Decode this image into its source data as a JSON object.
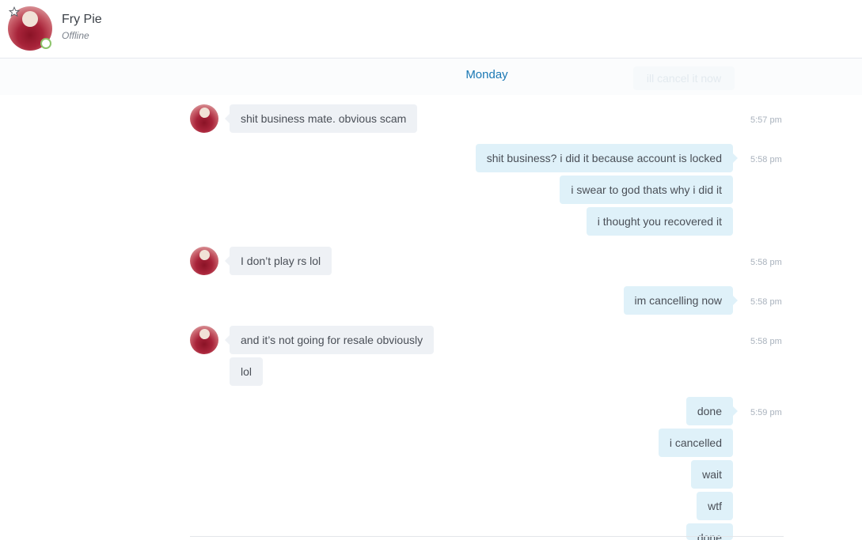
{
  "header": {
    "contact_name": "Fry Pie",
    "contact_status": "Offline"
  },
  "day": {
    "label": "Monday",
    "ghost_text": "ill cancel it now"
  },
  "messages": [
    {
      "text": "shit business mate. obvious scam",
      "time": "5:57 pm"
    },
    {
      "text": "shit business? i did it because account is locked",
      "time": "5:58 pm"
    },
    {
      "text": "i swear to god thats why i did it"
    },
    {
      "text": "i thought you recovered it"
    },
    {
      "text": "I don’t play rs lol",
      "time": "5:58 pm"
    },
    {
      "text": "im cancelling now",
      "time": "5:58 pm"
    },
    {
      "text": "and it’s not going for resale obviously",
      "time": "5:58 pm"
    },
    {
      "text": "lol"
    },
    {
      "text": "done",
      "time": "5:59 pm"
    },
    {
      "text": "i cancelled"
    },
    {
      "text": "wait"
    },
    {
      "text": "wtf"
    },
    {
      "text": "done"
    }
  ],
  "colors": {
    "accent": "#1a78b4",
    "incoming_bubble": "#eef1f5",
    "outgoing_bubble": "#dff1f9",
    "presence_ring": "#8cc46b"
  },
  "icons": {
    "favorite": "star-icon",
    "presence": "presence-dot"
  }
}
